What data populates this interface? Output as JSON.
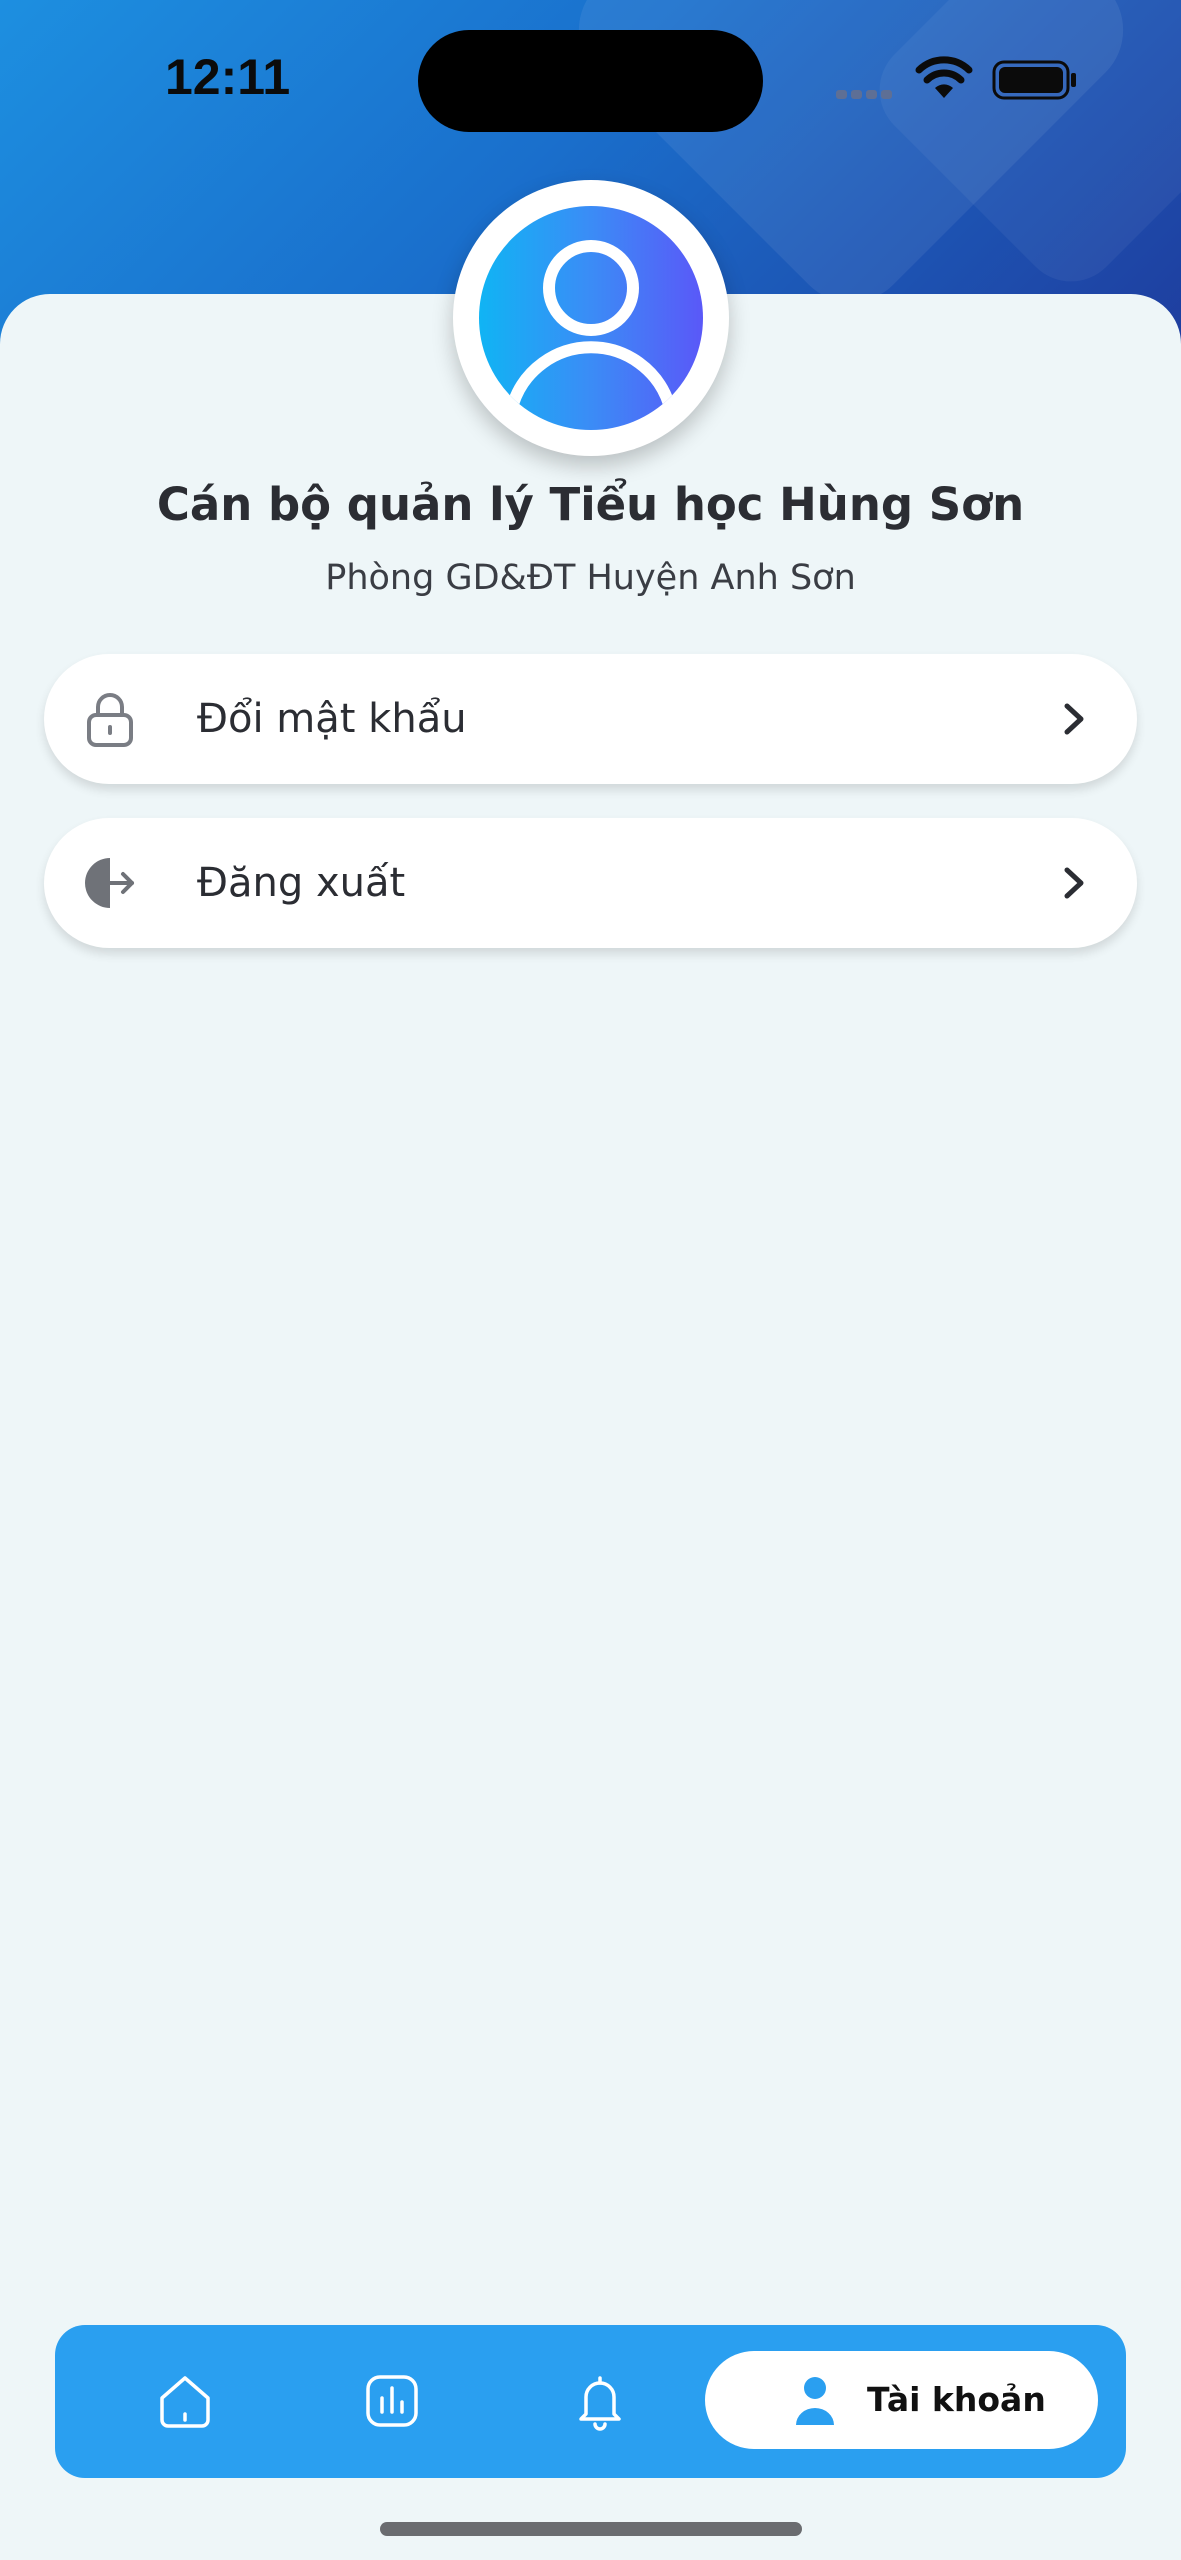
{
  "status_bar": {
    "time": "12:11"
  },
  "profile": {
    "name": "Cán bộ quản lý Tiểu học Hùng Sơn",
    "organization": "Phòng GD&ĐT Huyện Anh Sơn"
  },
  "menu": [
    {
      "label": "Đổi mật khẩu",
      "icon": "lock-icon"
    },
    {
      "label": "Đăng xuất",
      "icon": "logout-icon"
    }
  ],
  "bottom_nav": {
    "items": [
      {
        "icon": "home-icon"
      },
      {
        "icon": "chart-icon"
      },
      {
        "icon": "bell-icon"
      },
      {
        "icon": "user-icon",
        "label": "Tài khoản",
        "active": true
      }
    ]
  },
  "colors": {
    "header_gradient_start": "#1d8fe0",
    "header_gradient_end": "#1f3d9e",
    "nav_background": "#2a9ff0",
    "page_background": "#eef6f8"
  }
}
